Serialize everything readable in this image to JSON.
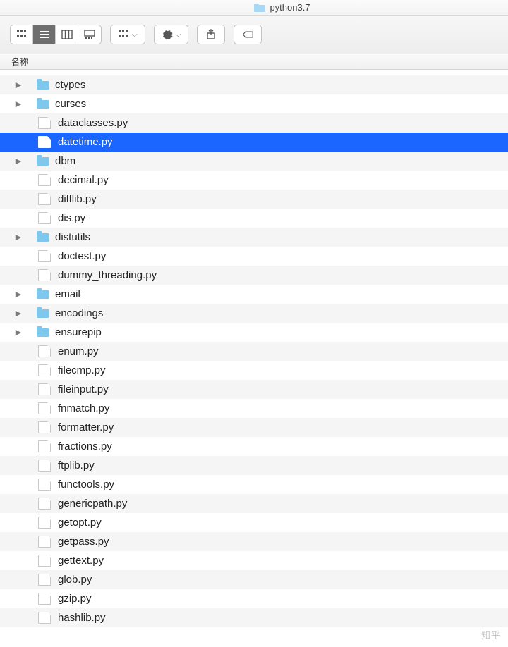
{
  "window": {
    "title": "python3.7"
  },
  "column_header": "名称",
  "watermark": "知乎",
  "items": [
    {
      "name": "ctypes",
      "kind": "folder",
      "expandable": true,
      "selected": false
    },
    {
      "name": "curses",
      "kind": "folder",
      "expandable": true,
      "selected": false
    },
    {
      "name": "dataclasses.py",
      "kind": "file",
      "expandable": false,
      "selected": false
    },
    {
      "name": "datetime.py",
      "kind": "file",
      "expandable": false,
      "selected": true
    },
    {
      "name": "dbm",
      "kind": "folder",
      "expandable": true,
      "selected": false
    },
    {
      "name": "decimal.py",
      "kind": "file",
      "expandable": false,
      "selected": false
    },
    {
      "name": "difflib.py",
      "kind": "file",
      "expandable": false,
      "selected": false
    },
    {
      "name": "dis.py",
      "kind": "file",
      "expandable": false,
      "selected": false
    },
    {
      "name": "distutils",
      "kind": "folder",
      "expandable": true,
      "selected": false
    },
    {
      "name": "doctest.py",
      "kind": "file",
      "expandable": false,
      "selected": false
    },
    {
      "name": "dummy_threading.py",
      "kind": "file",
      "expandable": false,
      "selected": false
    },
    {
      "name": "email",
      "kind": "folder",
      "expandable": true,
      "selected": false
    },
    {
      "name": "encodings",
      "kind": "folder",
      "expandable": true,
      "selected": false
    },
    {
      "name": "ensurepip",
      "kind": "folder",
      "expandable": true,
      "selected": false
    },
    {
      "name": "enum.py",
      "kind": "file",
      "expandable": false,
      "selected": false
    },
    {
      "name": "filecmp.py",
      "kind": "file",
      "expandable": false,
      "selected": false
    },
    {
      "name": "fileinput.py",
      "kind": "file",
      "expandable": false,
      "selected": false
    },
    {
      "name": "fnmatch.py",
      "kind": "file",
      "expandable": false,
      "selected": false
    },
    {
      "name": "formatter.py",
      "kind": "file",
      "expandable": false,
      "selected": false
    },
    {
      "name": "fractions.py",
      "kind": "file",
      "expandable": false,
      "selected": false
    },
    {
      "name": "ftplib.py",
      "kind": "file",
      "expandable": false,
      "selected": false
    },
    {
      "name": "functools.py",
      "kind": "file",
      "expandable": false,
      "selected": false
    },
    {
      "name": "genericpath.py",
      "kind": "file",
      "expandable": false,
      "selected": false
    },
    {
      "name": "getopt.py",
      "kind": "file",
      "expandable": false,
      "selected": false
    },
    {
      "name": "getpass.py",
      "kind": "file",
      "expandable": false,
      "selected": false
    },
    {
      "name": "gettext.py",
      "kind": "file",
      "expandable": false,
      "selected": false
    },
    {
      "name": "glob.py",
      "kind": "file",
      "expandable": false,
      "selected": false
    },
    {
      "name": "gzip.py",
      "kind": "file",
      "expandable": false,
      "selected": false
    },
    {
      "name": "hashlib.py",
      "kind": "file",
      "expandable": false,
      "selected": false
    }
  ]
}
